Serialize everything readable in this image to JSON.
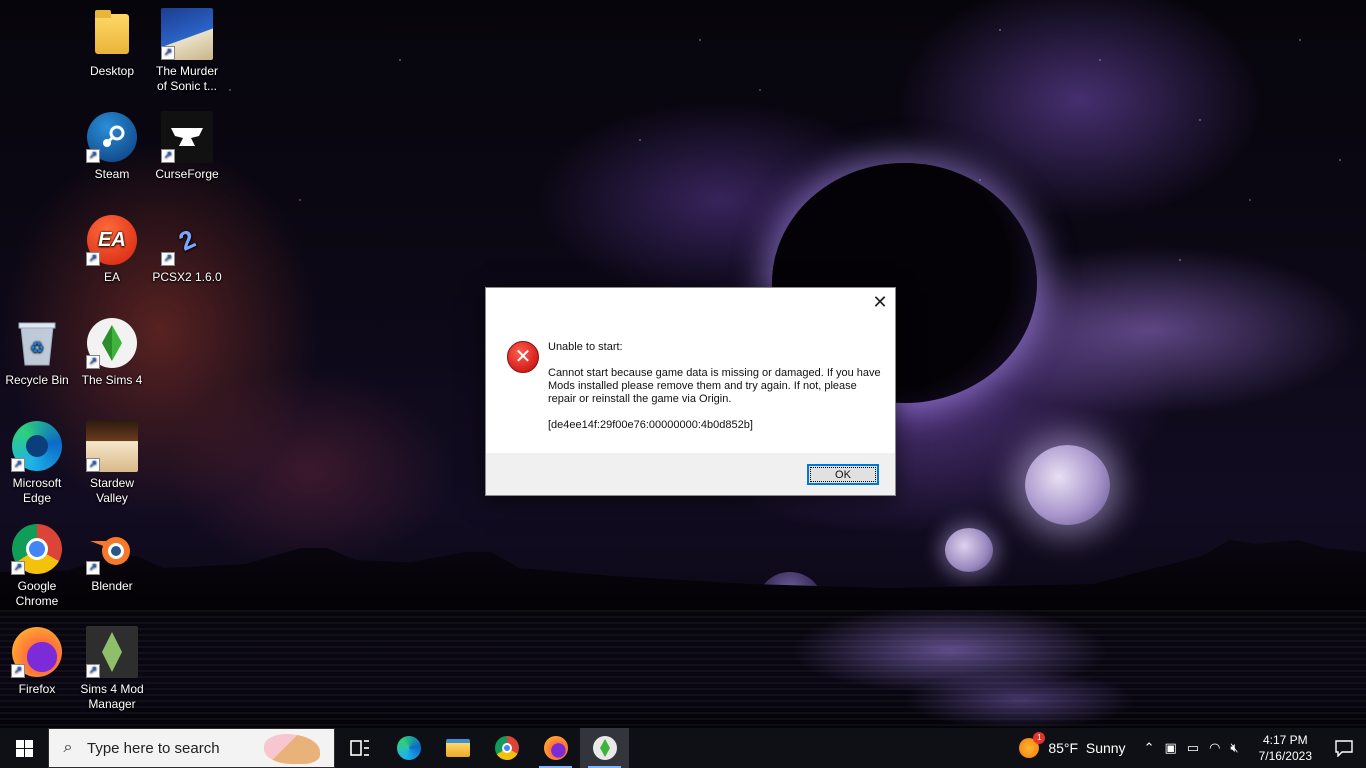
{
  "desktop": {
    "icons": [
      {
        "label": "Desktop",
        "icon": "folder-icon"
      },
      {
        "label": "The Murder of Sonic t...",
        "icon": "sonic-game-icon"
      },
      {
        "label": "Steam",
        "icon": "steam-icon"
      },
      {
        "label": "CurseForge",
        "icon": "curseforge-icon"
      },
      {
        "label": "EA",
        "icon": "ea-icon"
      },
      {
        "label": "PCSX2 1.6.0",
        "icon": "pcsx2-icon"
      },
      {
        "label": "Recycle Bin",
        "icon": "recycle-bin-icon"
      },
      {
        "label": "The Sims 4",
        "icon": "sims4-icon"
      },
      {
        "label": "Microsoft Edge",
        "icon": "edge-icon"
      },
      {
        "label": "Stardew Valley",
        "icon": "stardew-icon"
      },
      {
        "label": "Google Chrome",
        "icon": "chrome-icon"
      },
      {
        "label": "Blender",
        "icon": "blender-icon"
      },
      {
        "label": "Firefox",
        "icon": "firefox-icon"
      },
      {
        "label": "Sims 4 Mod Manager",
        "icon": "sims4-mod-manager-icon"
      }
    ]
  },
  "dialog": {
    "close_glyph": "✕",
    "heading": "Unable to start:",
    "message": "Cannot start because game data is missing or damaged. If you have Mods installed please remove them and try again.  If not, please repair or reinstall the game via Origin.",
    "error_code": "[de4ee14f:29f00e76:00000000:4b0d852b]",
    "ok_label": "OK",
    "icon": "error-icon",
    "icon_glyph": "✕"
  },
  "taskbar": {
    "search_placeholder": "Type here to search",
    "apps": [
      "task-view-icon",
      "edge-icon",
      "file-explorer-icon",
      "chrome-icon",
      "firefox-icon",
      "sims4-icon"
    ],
    "weather": {
      "temp": "85°F",
      "condition": "Sunny",
      "badge": "1"
    },
    "clock": {
      "time": "4:17 PM",
      "date": "7/16/2023"
    }
  },
  "colors": {
    "accent": "#0078d7",
    "error_red": "#d2201a",
    "taskbar_bg": "#0f1016"
  }
}
